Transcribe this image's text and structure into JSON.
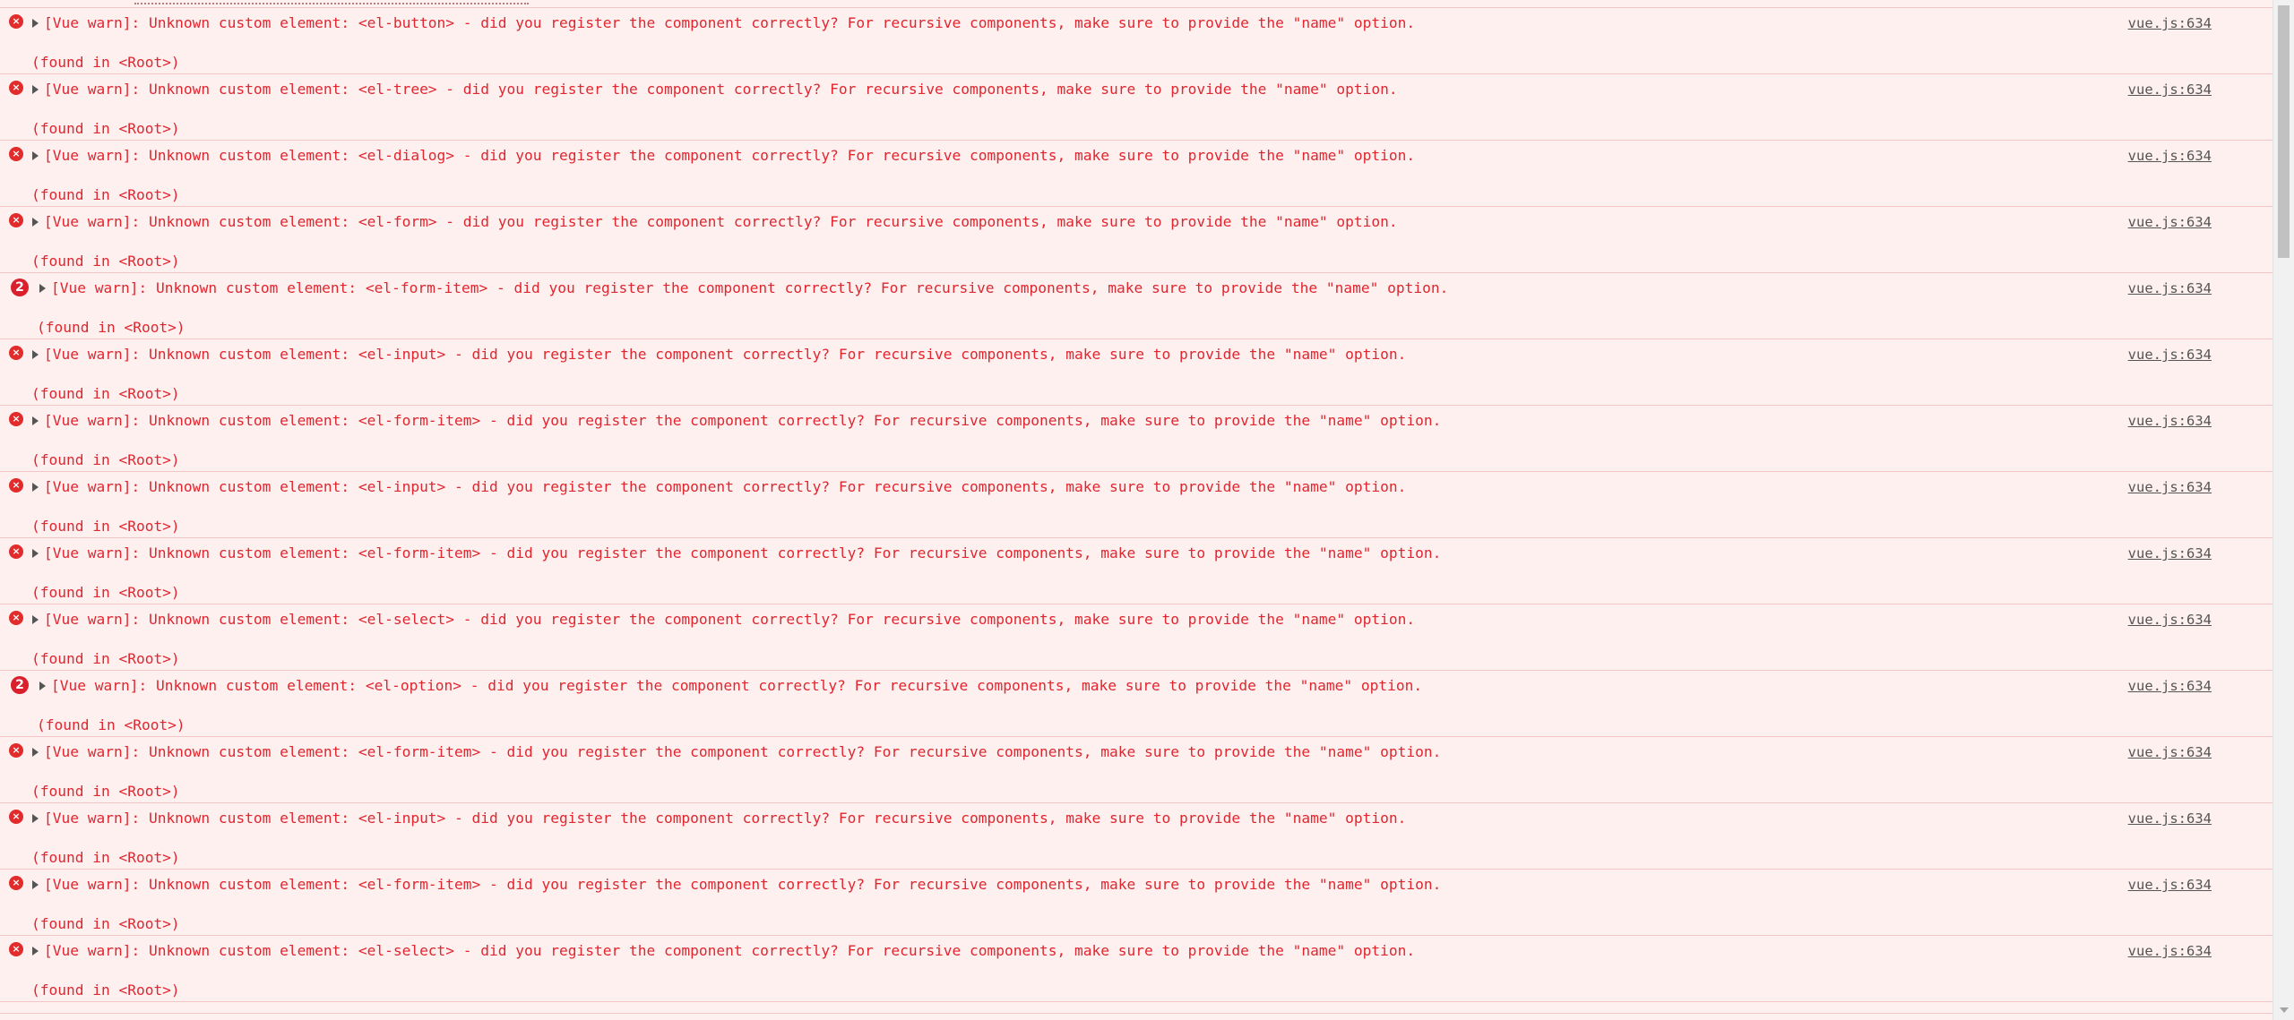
{
  "console": {
    "messages": [
      {
        "kind": "error",
        "count": "",
        "text": "[Vue warn]: Unknown custom element: <el-button> - did you register the component correctly? For recursive components, make sure to provide the \"name\" option.",
        "found": "(found in <Root>)",
        "source": "vue.js:634"
      },
      {
        "kind": "error",
        "count": "",
        "text": "[Vue warn]: Unknown custom element: <el-tree> - did you register the component correctly? For recursive components, make sure to provide the \"name\" option.",
        "found": "(found in <Root>)",
        "source": "vue.js:634"
      },
      {
        "kind": "error",
        "count": "",
        "text": "[Vue warn]: Unknown custom element: <el-dialog> - did you register the component correctly? For recursive components, make sure to provide the \"name\" option.",
        "found": "(found in <Root>)",
        "source": "vue.js:634"
      },
      {
        "kind": "error",
        "count": "",
        "text": "[Vue warn]: Unknown custom element: <el-form> - did you register the component correctly? For recursive components, make sure to provide the \"name\" option.",
        "found": "(found in <Root>)",
        "source": "vue.js:634"
      },
      {
        "kind": "grouped",
        "count": "2",
        "text": "[Vue warn]: Unknown custom element: <el-form-item> - did you register the component correctly? For recursive components, make sure to provide the \"name\" option.",
        "found": "(found in <Root>)",
        "source": "vue.js:634"
      },
      {
        "kind": "error",
        "count": "",
        "text": "[Vue warn]: Unknown custom element: <el-input> - did you register the component correctly? For recursive components, make sure to provide the \"name\" option.",
        "found": "(found in <Root>)",
        "source": "vue.js:634"
      },
      {
        "kind": "error",
        "count": "",
        "text": "[Vue warn]: Unknown custom element: <el-form-item> - did you register the component correctly? For recursive components, make sure to provide the \"name\" option.",
        "found": "(found in <Root>)",
        "source": "vue.js:634"
      },
      {
        "kind": "error",
        "count": "",
        "text": "[Vue warn]: Unknown custom element: <el-input> - did you register the component correctly? For recursive components, make sure to provide the \"name\" option.",
        "found": "(found in <Root>)",
        "source": "vue.js:634"
      },
      {
        "kind": "error",
        "count": "",
        "text": "[Vue warn]: Unknown custom element: <el-form-item> - did you register the component correctly? For recursive components, make sure to provide the \"name\" option.",
        "found": "(found in <Root>)",
        "source": "vue.js:634"
      },
      {
        "kind": "error",
        "count": "",
        "text": "[Vue warn]: Unknown custom element: <el-select> - did you register the component correctly? For recursive components, make sure to provide the \"name\" option.",
        "found": "(found in <Root>)",
        "source": "vue.js:634"
      },
      {
        "kind": "grouped",
        "count": "2",
        "text": "[Vue warn]: Unknown custom element: <el-option> - did you register the component correctly? For recursive components, make sure to provide the \"name\" option.",
        "found": "(found in <Root>)",
        "source": "vue.js:634"
      },
      {
        "kind": "error",
        "count": "",
        "text": "[Vue warn]: Unknown custom element: <el-form-item> - did you register the component correctly? For recursive components, make sure to provide the \"name\" option.",
        "found": "(found in <Root>)",
        "source": "vue.js:634"
      },
      {
        "kind": "error",
        "count": "",
        "text": "[Vue warn]: Unknown custom element: <el-input> - did you register the component correctly? For recursive components, make sure to provide the \"name\" option.",
        "found": "(found in <Root>)",
        "source": "vue.js:634"
      },
      {
        "kind": "error",
        "count": "",
        "text": "[Vue warn]: Unknown custom element: <el-form-item> - did you register the component correctly? For recursive components, make sure to provide the \"name\" option.",
        "found": "(found in <Root>)",
        "source": "vue.js:634"
      },
      {
        "kind": "error",
        "count": "",
        "text": "[Vue warn]: Unknown custom element: <el-select> - did you register the component correctly? For recursive components, make sure to provide the \"name\" option.",
        "found": "(found in <Root>)",
        "source": "vue.js:634"
      }
    ]
  },
  "icons": {
    "error": "error-icon",
    "expand": "expand-arrow-icon",
    "count_badge": "repeat-count-badge"
  },
  "colors": {
    "error_text": "#e0262f",
    "error_bg": "#fff0f0",
    "error_border": "#f5c6c6",
    "source_link": "#555555"
  }
}
